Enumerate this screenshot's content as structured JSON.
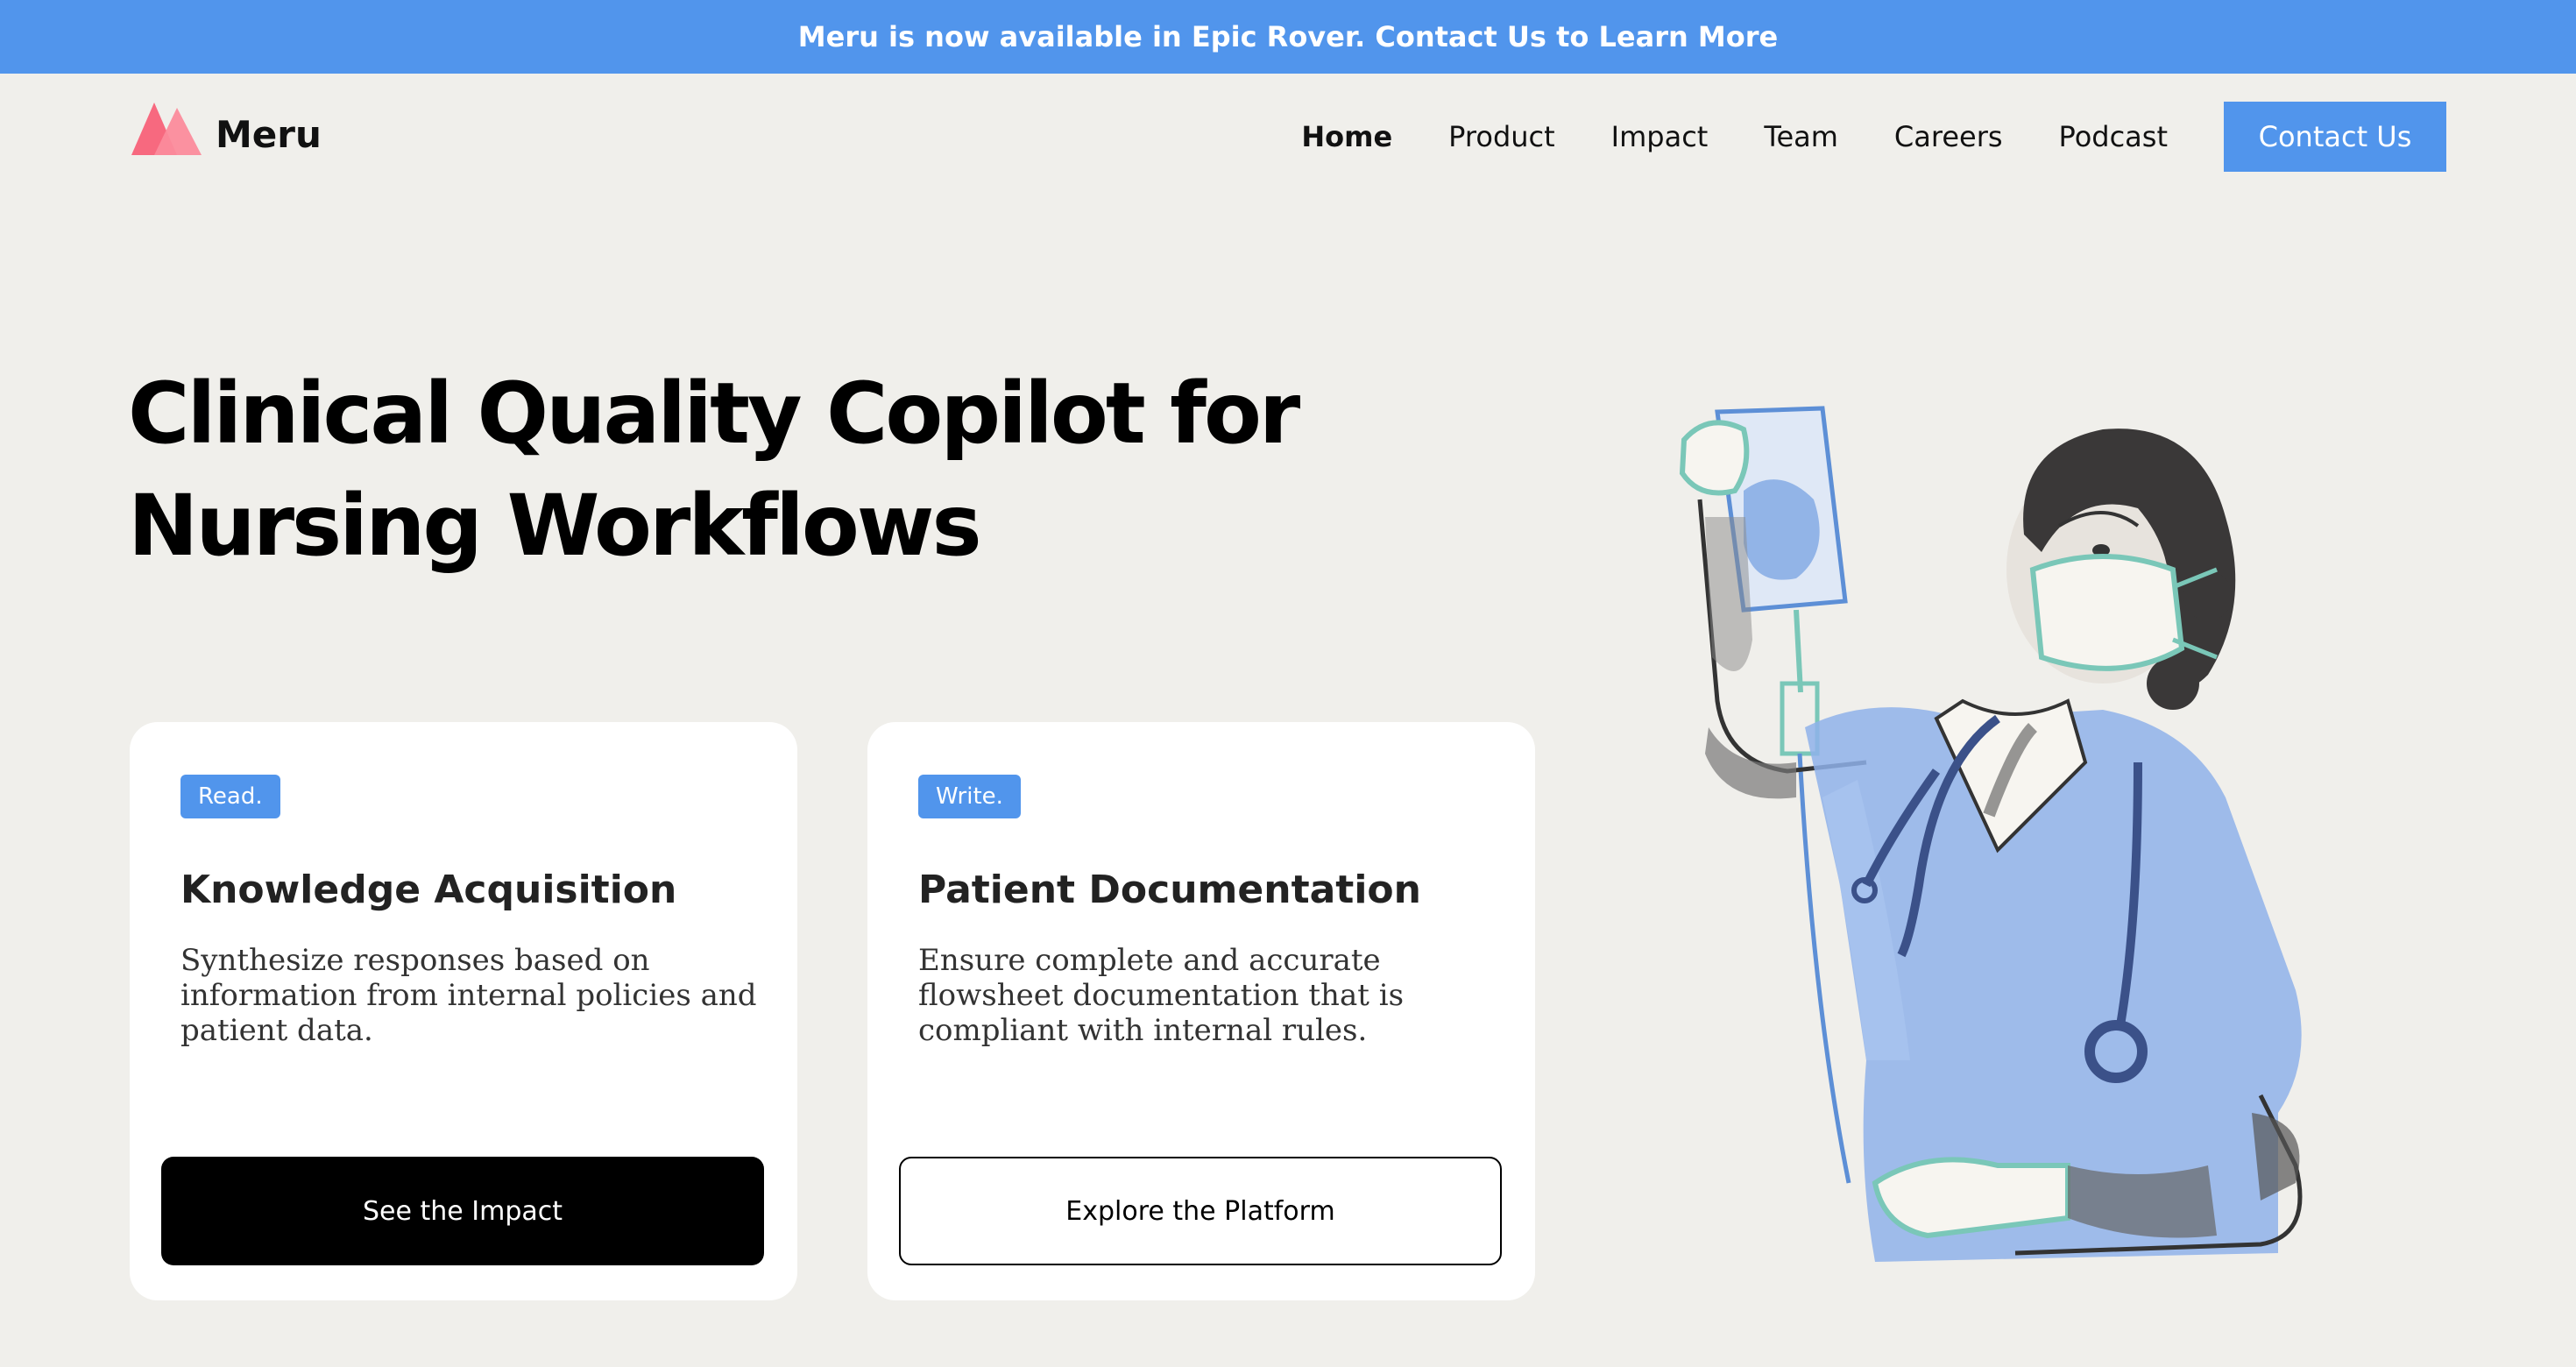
{
  "banner": {
    "text": "Meru is now available in Epic Rover. Contact Us to Learn More"
  },
  "brand": {
    "name": "Meru",
    "logo_colors": [
      "#f7697f",
      "#fb8b9c"
    ]
  },
  "nav": {
    "items": [
      {
        "label": "Home",
        "active": true
      },
      {
        "label": "Product",
        "active": false
      },
      {
        "label": "Impact",
        "active": false
      },
      {
        "label": "Team",
        "active": false
      },
      {
        "label": "Careers",
        "active": false
      },
      {
        "label": "Podcast",
        "active": false
      }
    ],
    "cta_label": "Contact Us"
  },
  "hero": {
    "title": "Clinical Quality Copilot for Nursing Workflows"
  },
  "cards": [
    {
      "tag": "Read.",
      "title": "Knowledge Acquisition",
      "description": "Synthesize responses based on information from internal policies and patient data.",
      "button": "See the Impact"
    },
    {
      "tag": "Write.",
      "title": "Patient Documentation",
      "description": "Ensure complete and accurate flowsheet documentation that is compliant with internal rules.",
      "button": "Explore the Platform"
    }
  ],
  "colors": {
    "accent": "#5195ec",
    "background": "#f0efeb",
    "card": "#ffffff"
  },
  "icons": {
    "logo": "mountain-logo-icon",
    "illustration": "nurse-holding-iv-bag-illustration"
  }
}
